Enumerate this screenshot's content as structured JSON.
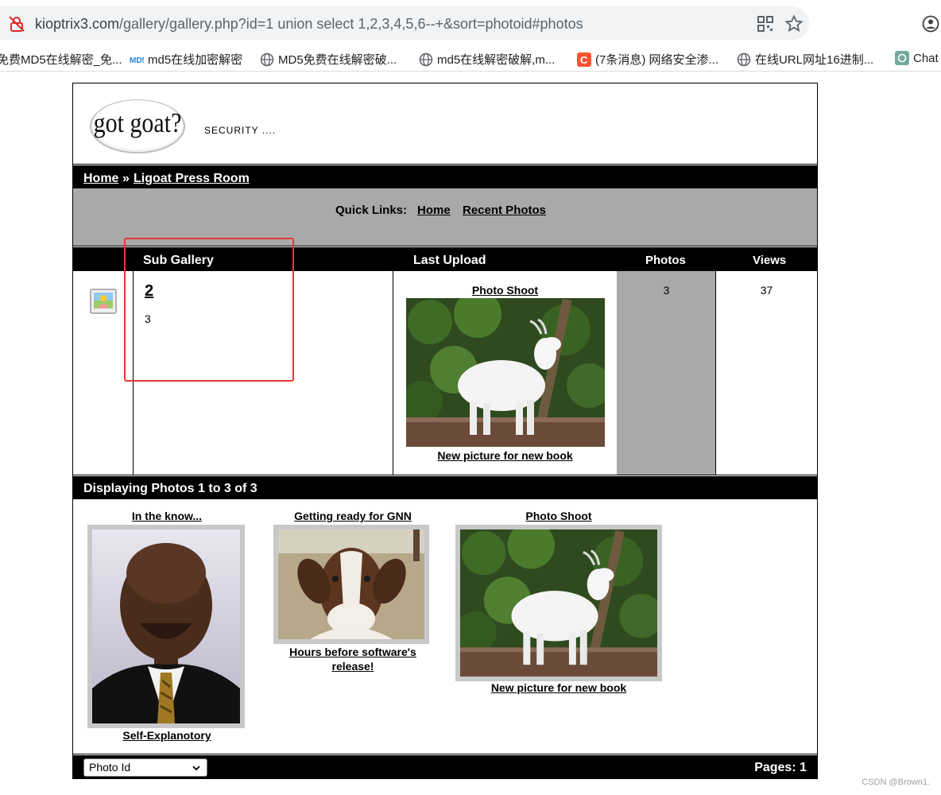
{
  "browser": {
    "url_domain": "kioptrix3.com",
    "url_path": "/gallery/gallery.php?id=1 union select 1,2,3,4,5,6--+&sort=photoid#photos",
    "bookmarks": [
      {
        "label": "免费MD5在线解密_免...",
        "icon": "md5-site-icon"
      },
      {
        "label": "md5在线加密解密",
        "icon": "md5-logo-icon"
      },
      {
        "label": "MD5免费在线解密破...",
        "icon": "globe-icon"
      },
      {
        "label": "md5在线解密破解,m...",
        "icon": "globe-icon"
      },
      {
        "label": "(7条消息) 网络安全渗...",
        "icon": "csdn-icon"
      },
      {
        "label": "在线URL网址16进制...",
        "icon": "globe-icon"
      },
      {
        "label": "Chat",
        "icon": "chatgpt-icon"
      }
    ]
  },
  "site": {
    "logo_text": "got goat?",
    "tagline": "SECURITY ....",
    "breadcrumb": {
      "home": "Home",
      "sep": "»",
      "current": "Ligoat Press Room"
    },
    "quick_links": {
      "label": "Quick Links:",
      "home": "Home",
      "recent": "Recent Photos"
    }
  },
  "table": {
    "headers": {
      "sub_gallery": "Sub Gallery",
      "last_upload": "Last Upload",
      "photos": "Photos",
      "views": "Views"
    },
    "row": {
      "name": "2",
      "description": "3",
      "last_title": "Photo Shoot",
      "last_caption": "New picture for new book",
      "photos": "3",
      "views": "37"
    }
  },
  "photos": {
    "heading": "Displaying Photos 1 to 3 of 3",
    "items": [
      {
        "title": "In the know...",
        "caption": "Self-Explanotory"
      },
      {
        "title": "Getting ready for GNN",
        "caption": "Hours before software's release!"
      },
      {
        "title": "Photo Shoot",
        "caption": "New picture for new book"
      }
    ]
  },
  "footer": {
    "sort_selected": "Photo Id",
    "pages": "Pages: 1"
  },
  "watermark": "CSDN @Brown1.",
  "colors": {
    "bar": "#000000",
    "gray_panel": "#a9a9a9",
    "annotation": "#e53935"
  }
}
